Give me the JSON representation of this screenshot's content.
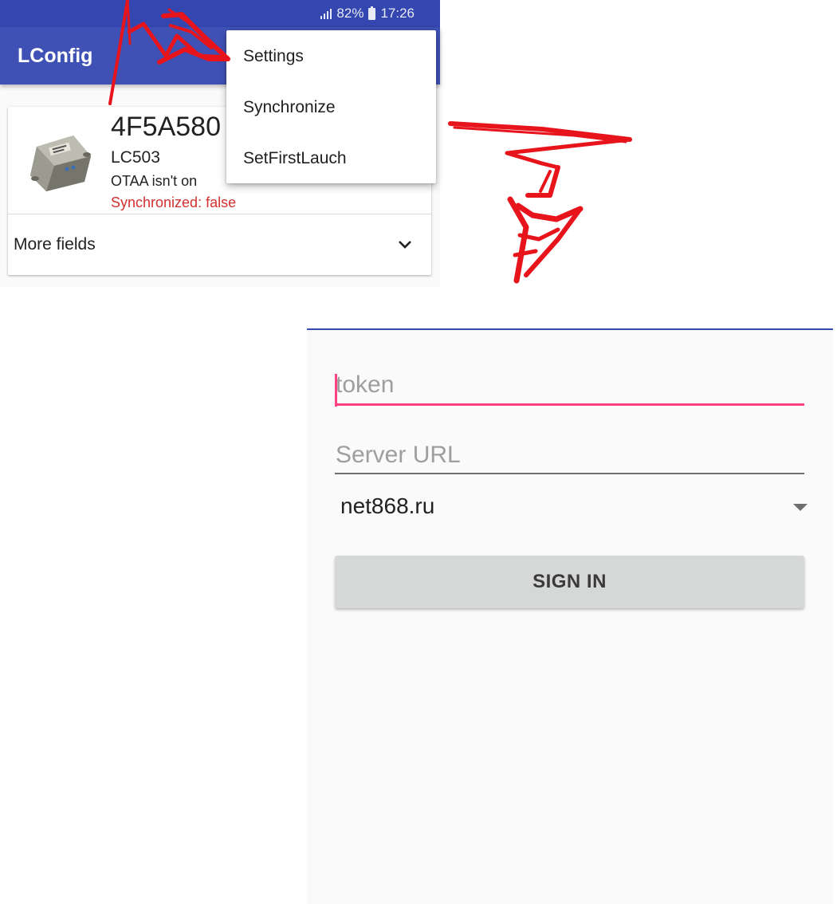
{
  "status_bar": {
    "battery": "82%",
    "time": "17:26"
  },
  "app_bar": {
    "title": "LConfig"
  },
  "device_card": {
    "device_id": "4F5A580",
    "model": "LC503",
    "otaa_status": "OTAA isn't on",
    "sync_status": "Synchronized: false",
    "more_fields_label": "More fields"
  },
  "overflow_menu": {
    "items": [
      {
        "label": "Settings"
      },
      {
        "label": "Synchronize"
      },
      {
        "label": "SetFirstLauch"
      }
    ]
  },
  "login": {
    "token_placeholder": "token",
    "server_url_placeholder": "Server URL",
    "server_selected": "net868.ru",
    "sign_in_label": "SIGN IN"
  },
  "colors": {
    "primary": "#3f51b5",
    "status_bar": "#3446b0",
    "accent": "#ff4081",
    "error_text": "#d32f2f",
    "annotation_red": "#e8141c"
  },
  "icons": [
    "signal-icon",
    "battery-icon",
    "device-image",
    "chevron-down-icon",
    "dropdown-arrow-icon"
  ]
}
